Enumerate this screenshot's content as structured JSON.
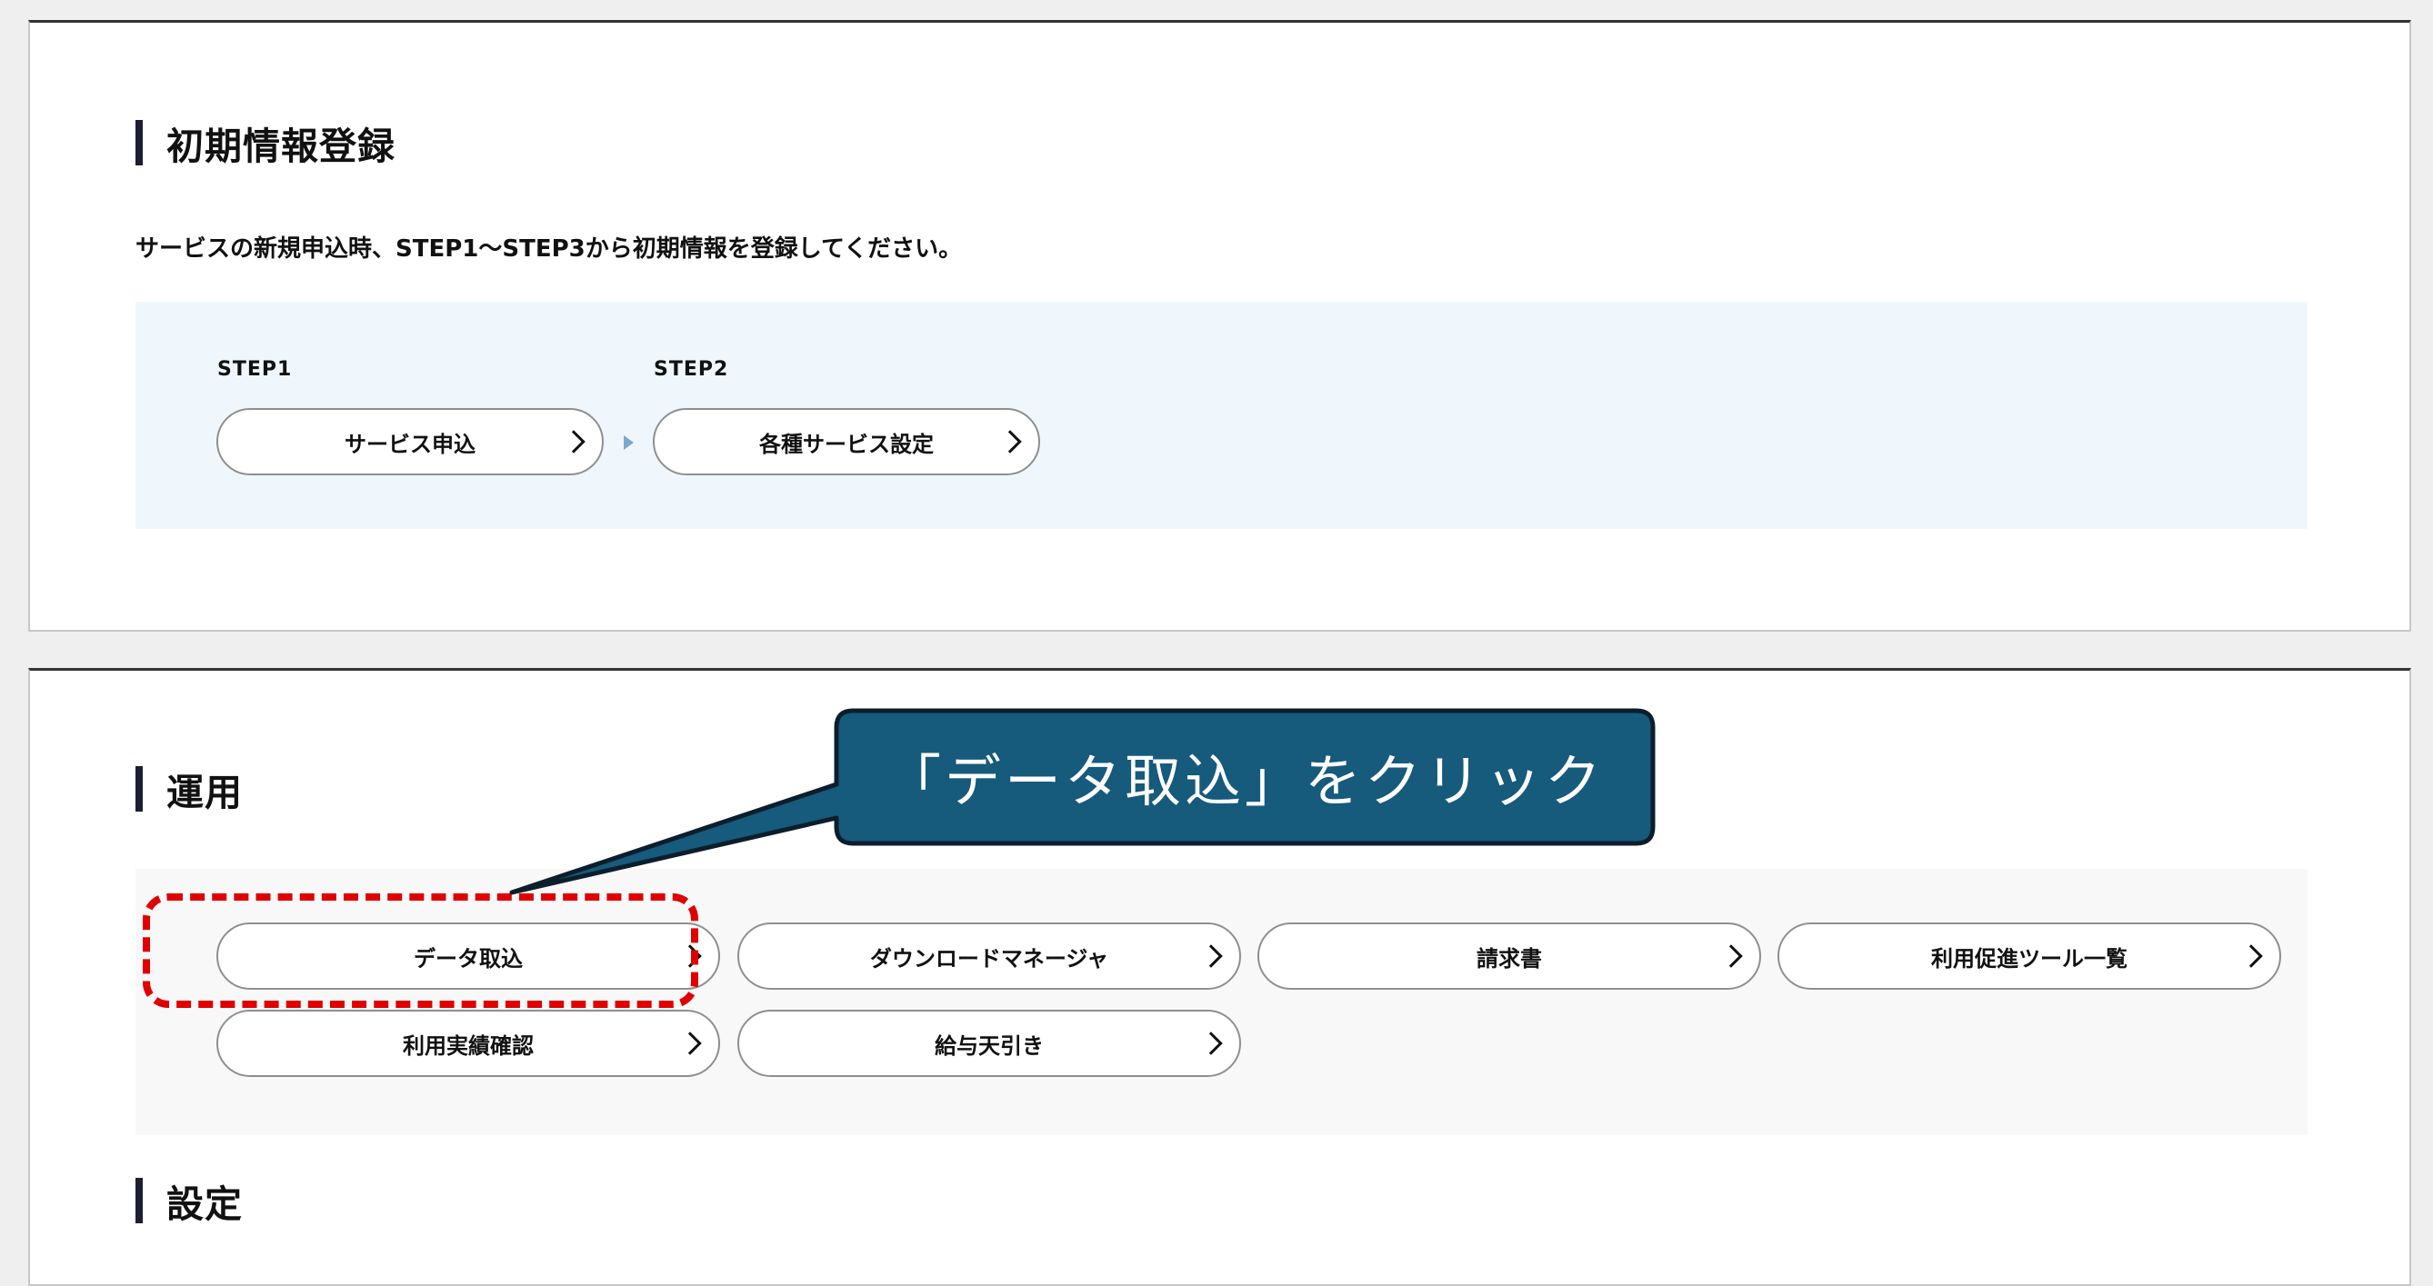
{
  "initial_setup": {
    "heading": "初期情報登録",
    "description": "サービスの新規申込時、STEP1〜STEP3から初期情報を登録してください。",
    "steps": [
      {
        "label": "STEP1",
        "button": "サービス申込"
      },
      {
        "label": "STEP2",
        "button": "各種サービス設定"
      }
    ]
  },
  "operations": {
    "heading": "運用",
    "buttons": [
      "データ取込",
      "ダウンロードマネージャ",
      "請求書",
      "利用促進ツール一覧",
      "利用実績確認",
      "給与天引き"
    ]
  },
  "settings": {
    "heading": "設定"
  },
  "callout": {
    "text": "「データ取込」をクリック",
    "fill_color": "#165a7c",
    "border_color": "#0c1e2b"
  },
  "highlight_color": "#e00000"
}
